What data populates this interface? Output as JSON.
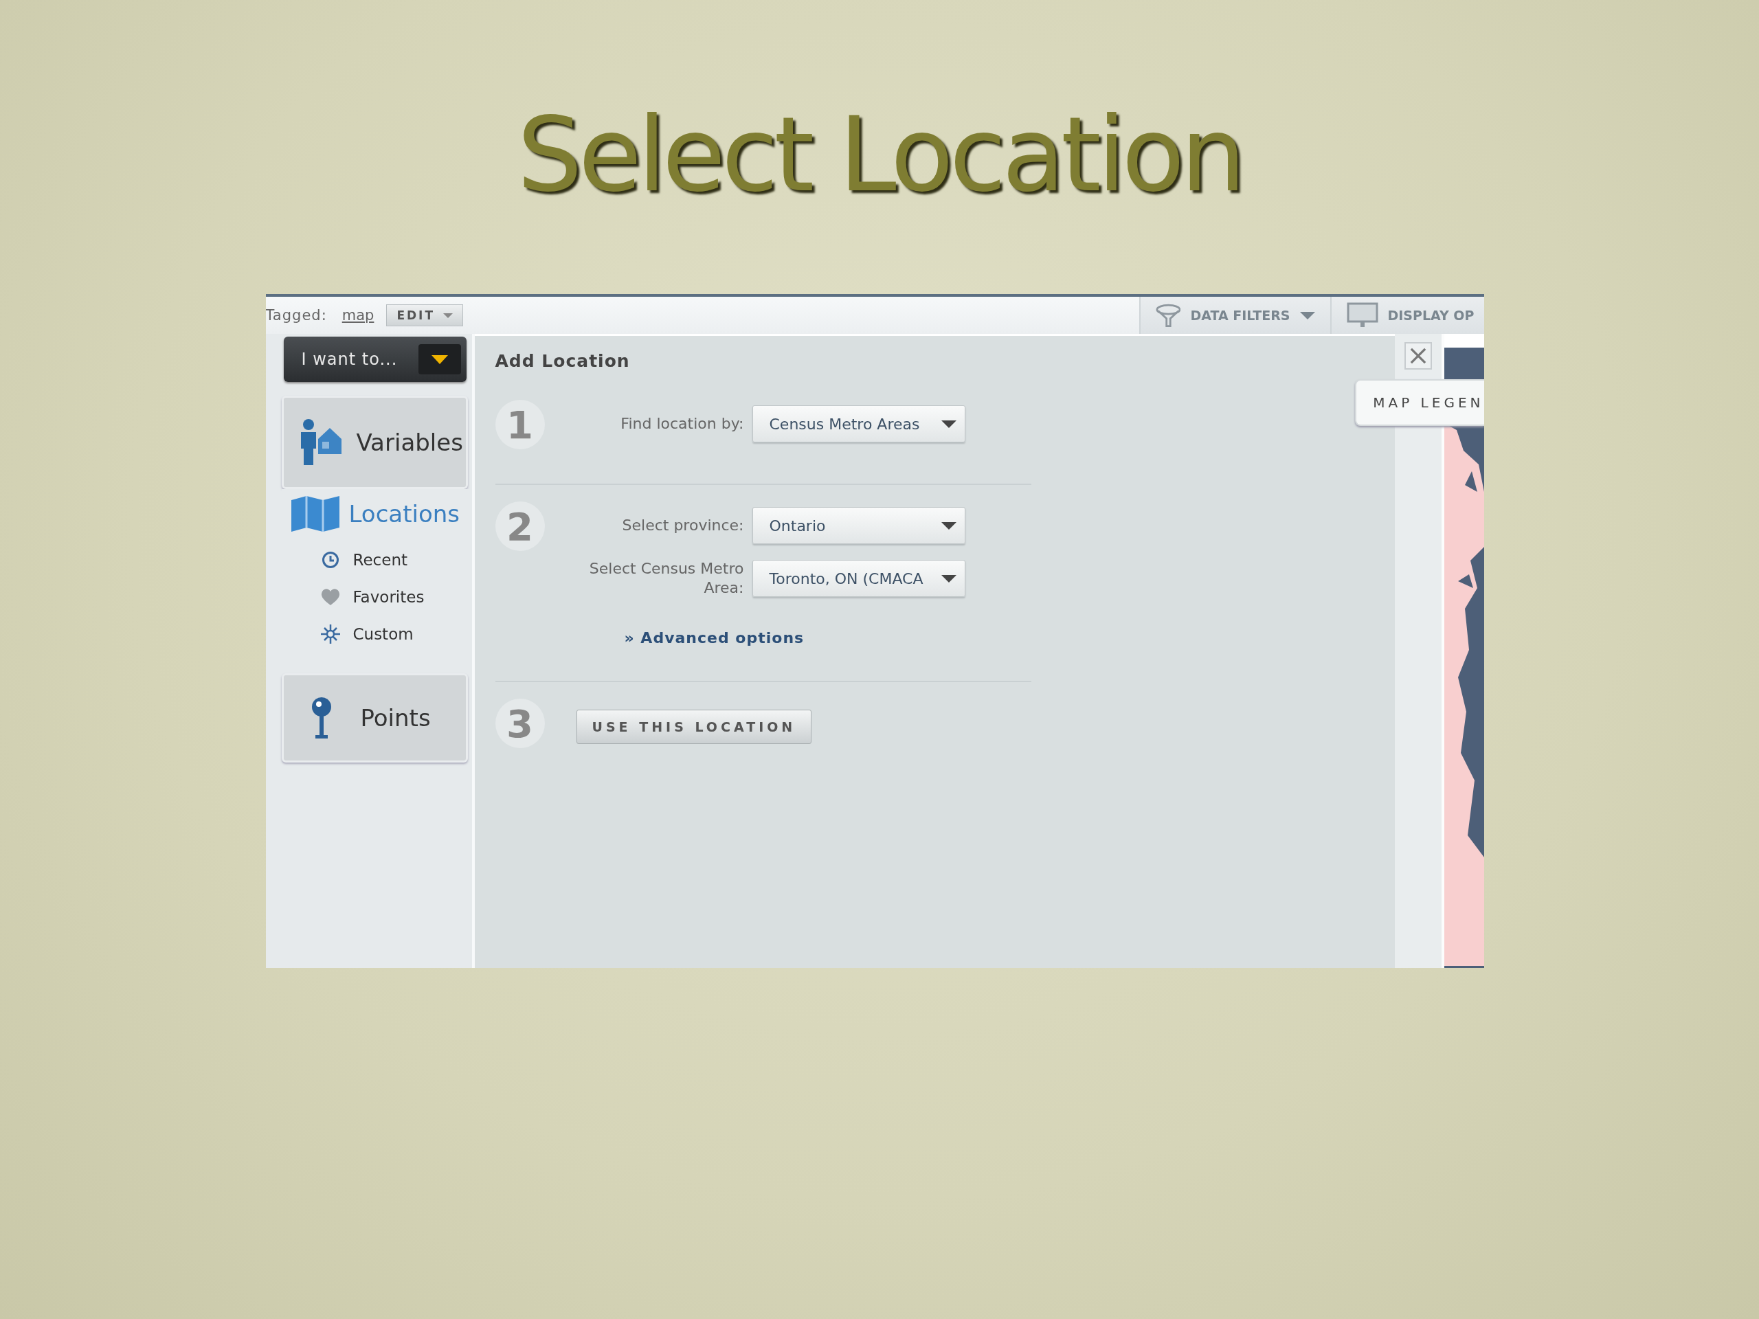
{
  "slide": {
    "title": "Select Location"
  },
  "app": {
    "toolbar": {
      "tagged_label": "Tagged:",
      "tag": "map",
      "edit_button": "EDIT",
      "tabs": [
        {
          "label": "DATA FILTERS",
          "kind": "filter"
        },
        {
          "label": "DISPLAY OP",
          "kind": "display"
        }
      ]
    },
    "menu_button": "I want to...",
    "sidebar": [
      {
        "label": "Variables",
        "kind": "variables",
        "selected": false
      },
      {
        "label": "Locations",
        "kind": "locations",
        "selected": true,
        "children": [
          {
            "label": "Recent",
            "kind": "recent"
          },
          {
            "label": "Favorites",
            "kind": "favorites"
          },
          {
            "label": "Custom",
            "kind": "custom"
          }
        ]
      },
      {
        "label": "Points",
        "kind": "points",
        "selected": false
      }
    ],
    "panel": {
      "title": "Add Location",
      "steps": [
        {
          "number": "1",
          "fields": [
            {
              "label": "Find location by:",
              "value": "Census Metro Areas"
            }
          ]
        },
        {
          "number": "2",
          "fields": [
            {
              "label": "Select province:",
              "value": "Ontario"
            },
            {
              "label": "Select Census Metro Area:",
              "value": "Toronto, ON (CMACA"
            }
          ],
          "link": "» Advanced options"
        },
        {
          "number": "3",
          "button": "USE THIS LOCATION"
        }
      ]
    },
    "map_legend": "MAP LEGEN"
  }
}
